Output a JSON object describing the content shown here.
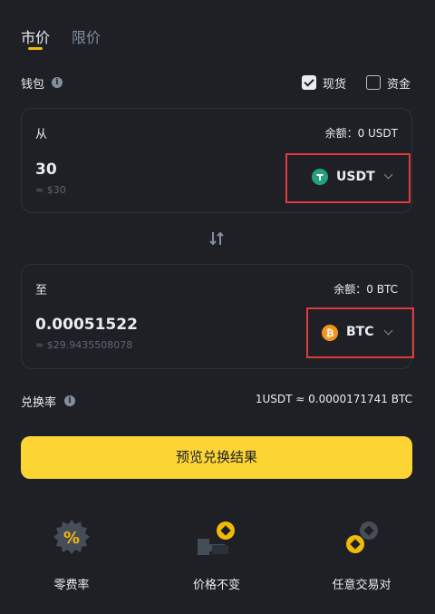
{
  "tabs": {
    "market": "市价",
    "limit": "限价"
  },
  "wallet": {
    "label": "钱包",
    "spot": "现货",
    "funding": "资金",
    "spot_checked": true,
    "funding_checked": false
  },
  "from": {
    "label": "从",
    "balance": "余额：0 USDT",
    "amount": "30",
    "approx": "≈ $30",
    "coin": "USDT"
  },
  "to": {
    "label": "至",
    "balance": "余额：0 BTC",
    "amount": "0.00051522",
    "approx": "≈ $29.9435508078",
    "coin": "BTC"
  },
  "rate": {
    "label": "兑换率",
    "value": "1USDT ≈ 0.0000171741 BTC"
  },
  "preview_button": "预览兑换结果",
  "features": [
    {
      "label": "零费率",
      "icon": "percent-badge-icon"
    },
    {
      "label": "价格不变",
      "icon": "locked-price-icon"
    },
    {
      "label": "任意交易对",
      "icon": "any-pair-icon"
    }
  ],
  "colors": {
    "accent": "#fcd535",
    "usdt": "#26a17b",
    "btc": "#f7931a",
    "highlight_box": "#e03b3b"
  }
}
